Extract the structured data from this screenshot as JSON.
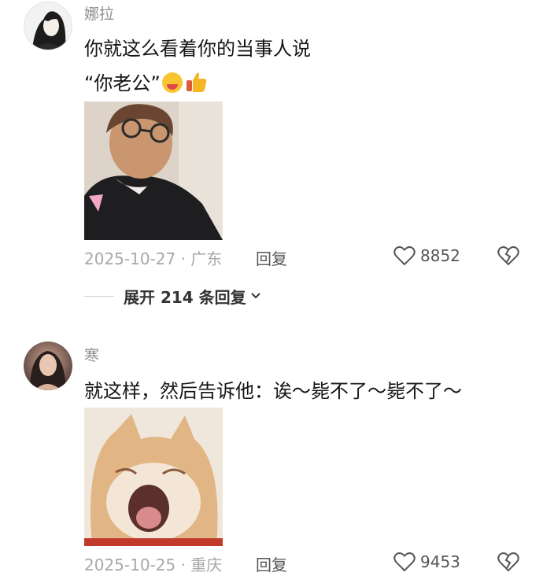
{
  "comments": [
    {
      "username": "娜拉",
      "text_line1": "你就这么看着你的当事人说",
      "text_line2": "“你老公”",
      "image_icon": "photo-woman-glasses",
      "date_location": "2025-10-27 · 广东",
      "reply_label": "回复",
      "likes": "8852",
      "expand_label": "展开 214 条回复",
      "emojis": [
        "wink-tongue-emoji",
        "thumbs-up-emoji"
      ]
    },
    {
      "username": "寒",
      "text_line1": "就这样，然后告诉他：诶～毙不了～毙不了～",
      "image_icon": "photo-yawning-cat",
      "date_location": "2025-10-25 · 重庆",
      "reply_label": "回复",
      "likes": "9453"
    }
  ],
  "colors": {
    "text": "#151515",
    "muted": "#a8a8a8",
    "username": "#8e8e8e"
  }
}
